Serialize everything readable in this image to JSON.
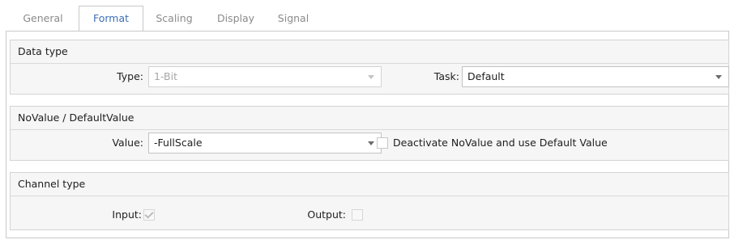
{
  "tabs": [
    {
      "label": "General",
      "active": false
    },
    {
      "label": "Format",
      "active": true
    },
    {
      "label": "Scaling",
      "active": false
    },
    {
      "label": "Display",
      "active": false
    },
    {
      "label": "Signal",
      "active": false
    }
  ],
  "data_type": {
    "title": "Data type",
    "type_label": "Type:",
    "type_value": "1-Bit",
    "type_enabled": false,
    "task_label": "Task:",
    "task_value": "Default"
  },
  "novalue": {
    "title": "NoValue / DefaultValue",
    "value_label": "Value:",
    "value_value": "-FullScale",
    "deactivate_label": "Deactivate NoValue and use Default Value",
    "deactivate_checked": false
  },
  "channel_type": {
    "title": "Channel type",
    "input_label": "Input:",
    "input_checked": true,
    "input_enabled": false,
    "output_label": "Output:",
    "output_checked": false,
    "output_enabled": false
  },
  "colors": {
    "active_tab_text": "#3b6fb6",
    "inactive_tab_text": "#8a8a8a",
    "group_background": "#f6f6f6",
    "border": "#c9c9c9"
  },
  "icons": [
    "chevron-down-icon",
    "checkmark-icon"
  ]
}
